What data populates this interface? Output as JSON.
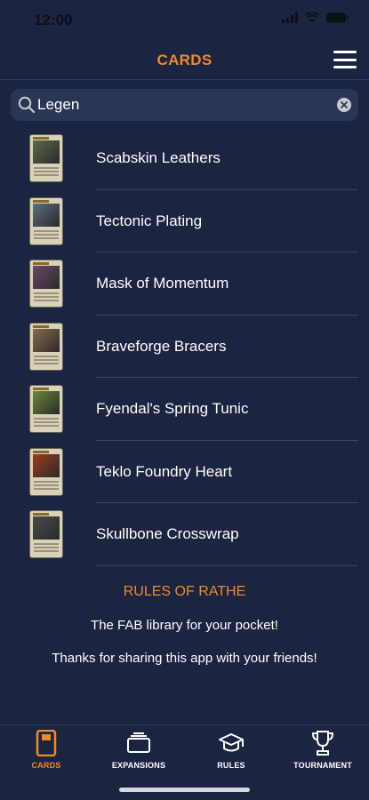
{
  "status_bar": {
    "time": "12:00"
  },
  "header": {
    "title": "CARDS"
  },
  "search": {
    "value": "Legen"
  },
  "cards": [
    {
      "name": "Scabskin Leathers",
      "art_color": "#5a6a4a"
    },
    {
      "name": "Tectonic Plating",
      "art_color": "#5b7080"
    },
    {
      "name": "Mask of Momentum",
      "art_color": "#6a4a6a"
    },
    {
      "name": "Braveforge Bracers",
      "art_color": "#8a6a4a"
    },
    {
      "name": "Fyendal's Spring Tunic",
      "art_color": "#6a8a3a"
    },
    {
      "name": "Teklo Foundry Heart",
      "art_color": "#a03a20"
    },
    {
      "name": "Skullbone Crosswrap",
      "art_color": "#4a4a4a"
    }
  ],
  "footer": {
    "title": "RULES OF RATHE",
    "line1": "The FAB library for your pocket!",
    "line2": "Thanks for sharing this app with your friends!"
  },
  "tabs": [
    {
      "label": "CARDS",
      "icon": "card-icon",
      "active": true
    },
    {
      "label": "EXPANSIONS",
      "icon": "expansions-icon",
      "active": false
    },
    {
      "label": "RULES",
      "icon": "graduation-cap-icon",
      "active": false
    },
    {
      "label": "TOURNAMENT",
      "icon": "trophy-icon",
      "active": false
    }
  ],
  "colors": {
    "accent": "#f08a24",
    "background": "#1b2440"
  }
}
